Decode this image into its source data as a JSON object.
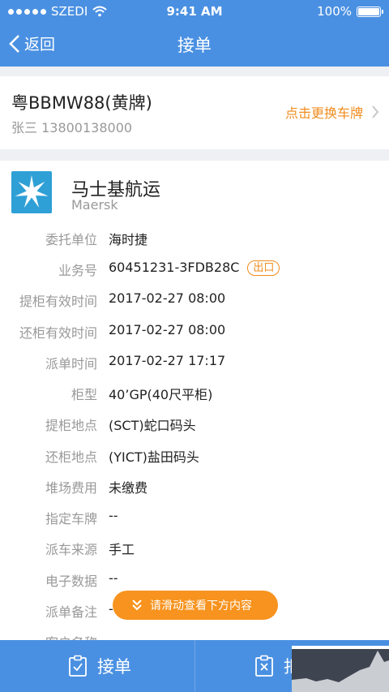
{
  "status_bar": {
    "carrier": "SZEDI",
    "time": "9:41 AM",
    "battery": "100%"
  },
  "nav": {
    "back_label": "返回",
    "title": "接单"
  },
  "vehicle": {
    "plate": "粤BBMW88(黄牌)",
    "driver": "张三 13800138000",
    "change_label": "点击更换车牌"
  },
  "order": {
    "company_cn": "马士基航运",
    "company_en": "Maersk",
    "badge": "出口",
    "fields": [
      {
        "label": "委托单位",
        "value": "海时捷"
      },
      {
        "label": "业务号",
        "value": "60451231-3FDB28C"
      },
      {
        "label": "提柜有效时间",
        "value": "2017-02-27 08:00"
      },
      {
        "label": "还柜有效时间",
        "value": "2017-02-27 08:00"
      },
      {
        "label": "派单时间",
        "value": "2017-02-27 17:17"
      },
      {
        "label": "柜型",
        "value": "40’GP(40尺平柜)"
      },
      {
        "label": "提柜地点",
        "value": "(SCT)蛇口码头"
      },
      {
        "label": "还柜地点",
        "value": "(YICT)盐田码头"
      },
      {
        "label": "堆场费用",
        "value": "未缴费"
      },
      {
        "label": "指定车牌",
        "value": "--"
      },
      {
        "label": "派车来源",
        "value": "手工"
      },
      {
        "label": "电子数据",
        "value": "--"
      },
      {
        "label": "派单备注",
        "value": "-"
      },
      {
        "label": "客户名称",
        "value": ""
      }
    ]
  },
  "scroll_hint": "请滑动查看下方内容",
  "actions": {
    "accept": "接单",
    "reject": "拒"
  },
  "colors": {
    "primary": "#4a90e2",
    "accent": "#f08c1e",
    "hint": "#f7931e"
  }
}
